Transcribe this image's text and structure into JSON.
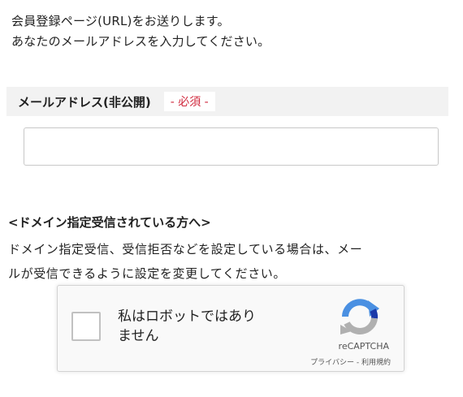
{
  "intro": {
    "line1": "会員登録ページ(URL)をお送りします。",
    "line2": "あなたのメールアドレスを入力してください。"
  },
  "email_field": {
    "label": "メールアドレス(非公開)",
    "required_badge": "- 必須 -",
    "value": "",
    "placeholder": ""
  },
  "domain_notice": {
    "heading": "<ドメイン指定受信されている方へ>",
    "line1": "ドメイン指定受信、受信拒否などを設定している場合は、メー",
    "line2": "ルが受信できるように設定を変更してください。"
  },
  "recaptcha": {
    "label_line1": "私はロボットではあり",
    "label_line2": "ません",
    "brand": "reCAPTCHA",
    "privacy": "プライバシー",
    "separator": " - ",
    "terms": "利用規約",
    "icon": "recaptcha-logo-icon"
  },
  "colors": {
    "required": "#d0283c",
    "header_bg": "#f2f2f2",
    "recaptcha_blue": "#4a90e2",
    "recaptcha_gray": "#b0b0b0"
  }
}
